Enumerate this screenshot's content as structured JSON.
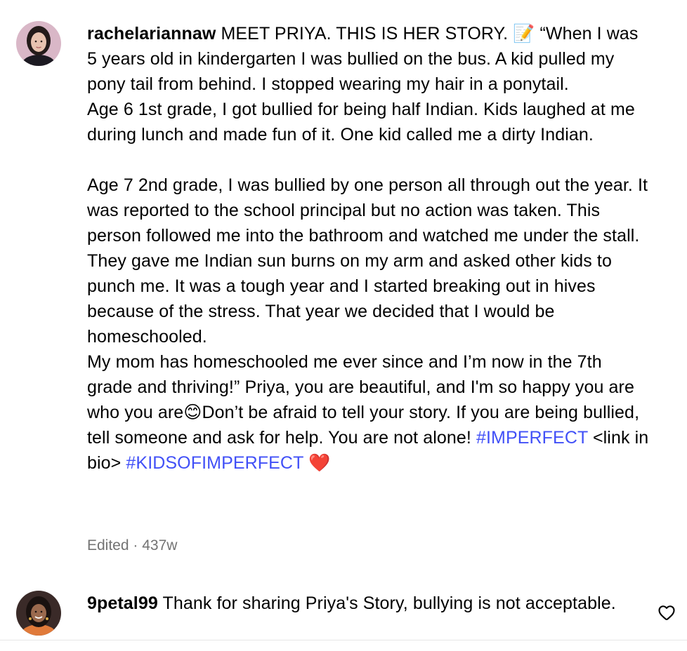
{
  "comments": [
    {
      "username": "rachelariannaw",
      "text_intro": " MEET PRIYA. THIS IS HER STORY. ",
      "memo_icon": "📝",
      "text_body": " “When I was 5 years old in kindergarten I was bullied on the bus. A kid pulled my pony tail from behind. I stopped wearing my hair in a ponytail.\nAge 6 1st grade, I got bullied for being half Indian. Kids laughed at me during lunch and made fun of it. One kid called me a dirty Indian.\n\nAge 7 2nd grade, I was bullied by one person all through out the year. It was reported to the school principal but no action was taken. This person followed me into the bathroom and watched me under the stall. They gave me Indian sun burns on my arm and asked other kids to punch me. It was a tough year and I started breaking out in hives because of the stress. That year we decided that I would be homeschooled.\nMy mom has homeschooled me ever since and I’m now in the 7th grade and thriving!” Priya, you are beautiful, and I'm so happy you are who you are",
      "smile_icon": "😊",
      "text_after_smile": "Don’t be afraid to tell your story. If you are being bullied, tell someone and ask for help. You are not alone! ",
      "hashtag_1": "#IMPERFECT",
      "link_text": " <link in bio> ",
      "hashtag_2": "#KIDSOFIMPERFECT",
      "heart_icon": " ❤️",
      "edited_label": "Edited",
      "separator": " · ",
      "age": "437w"
    },
    {
      "username": "9petal99",
      "text": " Thank for sharing Priya's Story, bullying is not acceptable."
    }
  ],
  "icons": {
    "like": "heart-outline-icon"
  },
  "colors": {
    "hashtag": "#4150f7",
    "meta": "#737373",
    "divider": "#e6e6e6"
  }
}
